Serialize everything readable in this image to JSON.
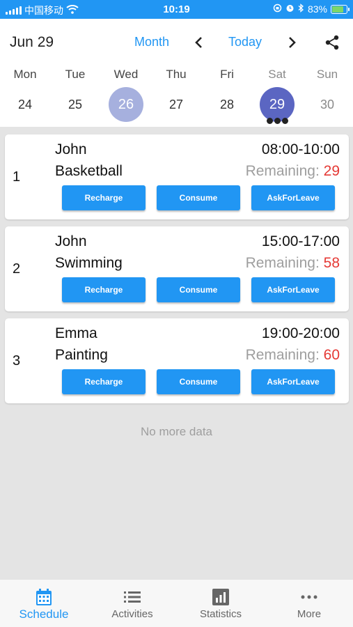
{
  "status_bar": {
    "carrier": "中国移动",
    "time": "10:19",
    "battery": "83%",
    "battery_level": 0.83
  },
  "header": {
    "date_title": "Jun 29",
    "month_label": "Month",
    "today_label": "Today",
    "week": [
      {
        "name": "Mon",
        "num": "24"
      },
      {
        "name": "Tue",
        "num": "25"
      },
      {
        "name": "Wed",
        "num": "26"
      },
      {
        "name": "Thu",
        "num": "27"
      },
      {
        "name": "Fri",
        "num": "28"
      },
      {
        "name": "Sat",
        "num": "29"
      },
      {
        "name": "Sun",
        "num": "30"
      }
    ]
  },
  "schedule": [
    {
      "index": "1",
      "person": "John",
      "activity": "Basketball",
      "time": "08:00-10:00",
      "remaining_label": "Remaining:",
      "remaining": "29"
    },
    {
      "index": "2",
      "person": "John",
      "activity": "Swimming",
      "time": "15:00-17:00",
      "remaining_label": "Remaining:",
      "remaining": "58"
    },
    {
      "index": "3",
      "person": "Emma",
      "activity": "Painting",
      "time": "19:00-20:00",
      "remaining_label": "Remaining:",
      "remaining": "60"
    }
  ],
  "buttons": {
    "recharge": "Recharge",
    "consume": "Consume",
    "leave": "AskForLeave"
  },
  "no_more": "No more data",
  "bottom_nav": {
    "schedule": "Schedule",
    "activities": "Activities",
    "statistics": "Statistics",
    "more": "More"
  },
  "colors": {
    "accent": "#2196f3",
    "selected_day": "#5b66c2",
    "today_day": "#a6b0de",
    "remaining_count": "#e53935"
  },
  "icons": [
    "wifi-icon",
    "chevron-left-icon",
    "chevron-right-icon",
    "share-icon",
    "calendar-icon",
    "list-icon",
    "bar-chart-icon",
    "more-dots-icon"
  ]
}
